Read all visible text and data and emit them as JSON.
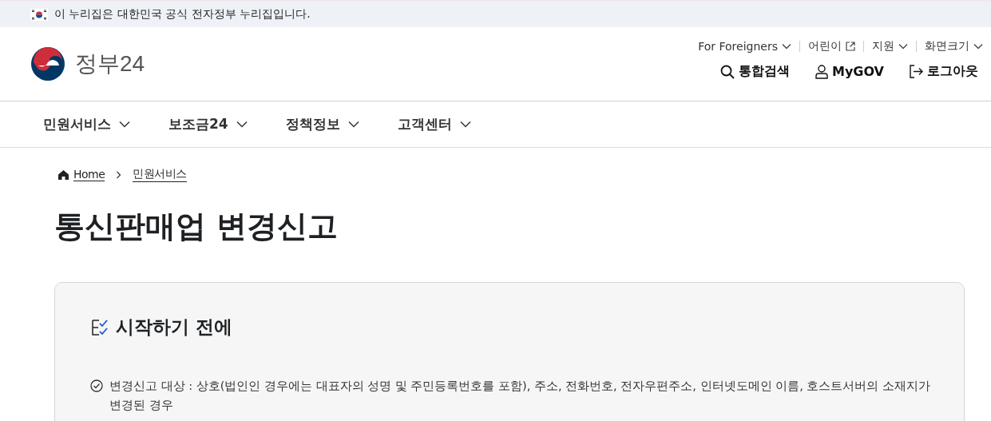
{
  "top_banner": {
    "text": "이 누리집은 대한민국 공식 전자정부 누리집입니다."
  },
  "header": {
    "logo_text": "정부24",
    "utility_links": [
      {
        "label": "For Foreigners",
        "kind": "dropdown"
      },
      {
        "label": "어린이",
        "kind": "external"
      },
      {
        "label": "지원",
        "kind": "dropdown"
      },
      {
        "label": "화면크기",
        "kind": "dropdown"
      }
    ],
    "actions": [
      {
        "label": "통합검색",
        "kind": "search"
      },
      {
        "label": "MyGOV",
        "kind": "user"
      },
      {
        "label": "로그아웃",
        "kind": "logout"
      }
    ]
  },
  "main_nav": [
    {
      "label": "민원서비스"
    },
    {
      "label": "보조금24"
    },
    {
      "label": "정책정보"
    },
    {
      "label": "고객센터"
    }
  ],
  "breadcrumb": [
    {
      "label": "Home",
      "kind": "home"
    },
    {
      "label": "민원서비스",
      "kind": "link"
    }
  ],
  "page_title": "통신판매업 변경신고",
  "info_card": {
    "heading": "시작하기 전에",
    "items": [
      "변경신고 대상 : 상호(법인인 경우에는 대표자의 성명 및 주민등록번호를 포함), 주소, 전화번호, 전자우편주소, 인터넷도메인 이름, 호스트서버의 소재지가 변경된 경우"
    ]
  }
}
